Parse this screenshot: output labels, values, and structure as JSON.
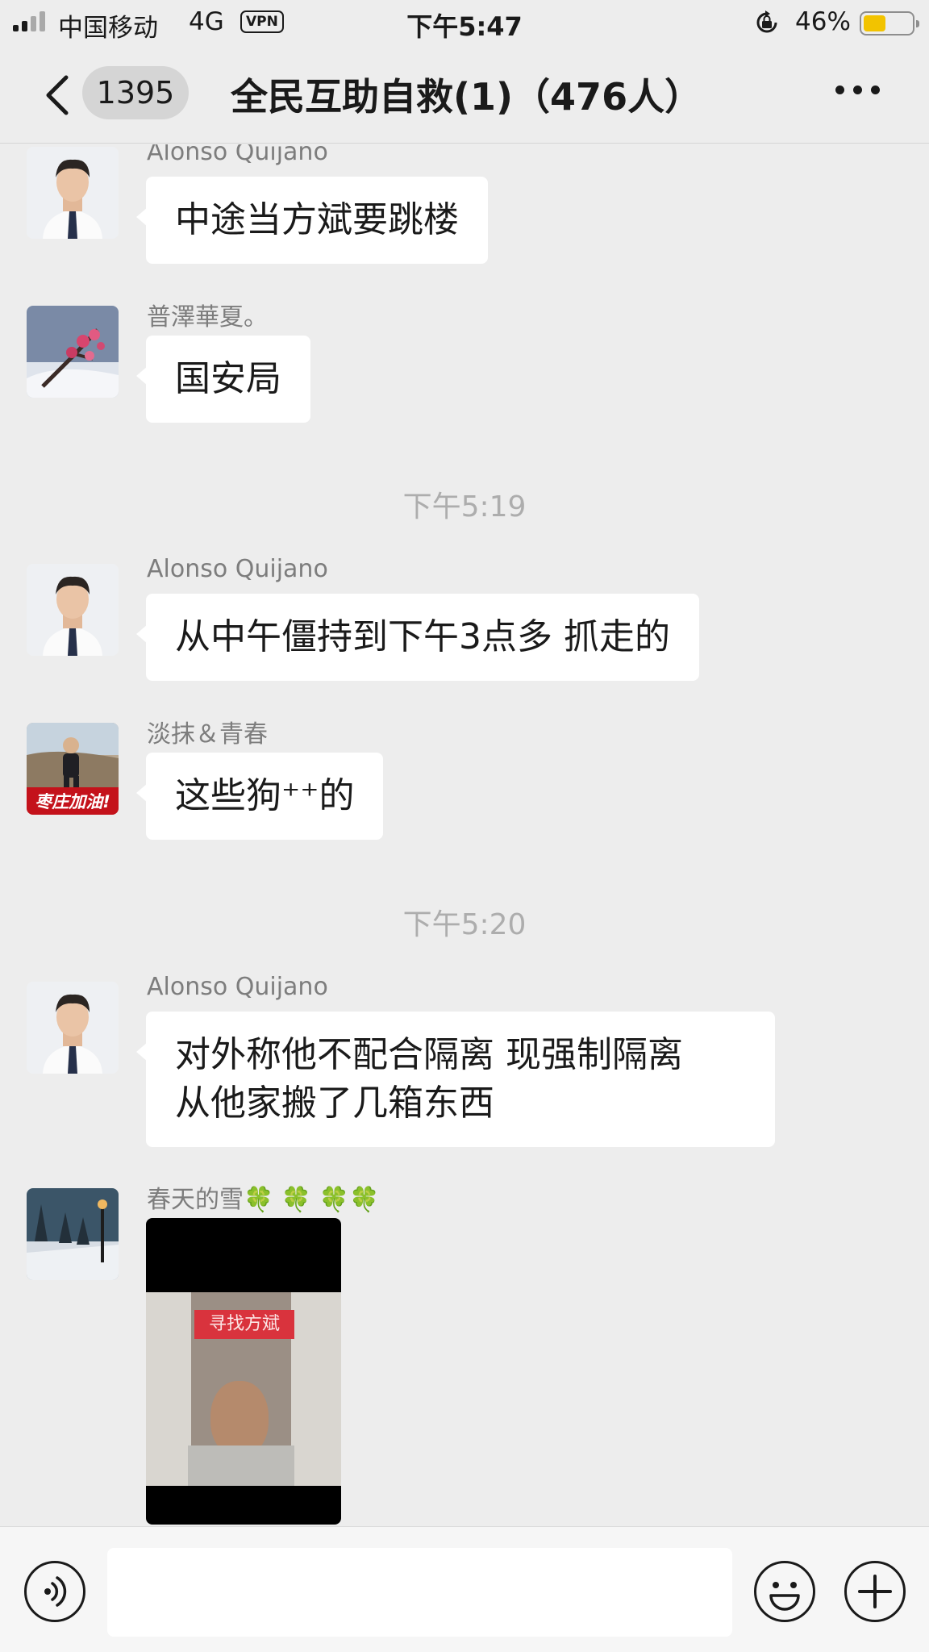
{
  "status_bar": {
    "carrier": "中国移动",
    "network": "4G",
    "vpn": "VPN",
    "time": "下午5:47",
    "battery": "46%",
    "battery_level": 0.46
  },
  "header": {
    "unread_count": "1395",
    "title": "全民互助自救(1)（476人）"
  },
  "messages": [
    {
      "sender": "Alonso Quijano",
      "text": "中途当方斌要跳楼"
    },
    {
      "sender": "普澤華夏。",
      "text": "国安局"
    },
    {
      "time": "下午5:19"
    },
    {
      "sender": "Alonso Quijano",
      "text": "从中午僵持到下午3点多 抓走的"
    },
    {
      "sender": "淡抹＆青春",
      "text": "这些狗⁺⁺的",
      "avatar_caption": "枣庄加油!"
    },
    {
      "time": "下午5:20"
    },
    {
      "sender": "Alonso Quijano",
      "lines": [
        "对外称他不配合隔离 现强制隔离",
        "从他家搬了几箱东西"
      ]
    },
    {
      "sender": "春天的雪🍀 🍀 🍀🍀",
      "video_caption": "寻找方斌"
    }
  ],
  "colors": {
    "background": "#ededed",
    "bubble": "#ffffff",
    "sender_text": "#7d7d7d",
    "time_text": "#adadad",
    "battery": "#f2c300"
  },
  "icons": [
    "back-icon",
    "more-icon",
    "voice-icon",
    "emoji-icon",
    "plus-icon",
    "signal-icon",
    "orientation-lock-icon",
    "battery-icon"
  ]
}
